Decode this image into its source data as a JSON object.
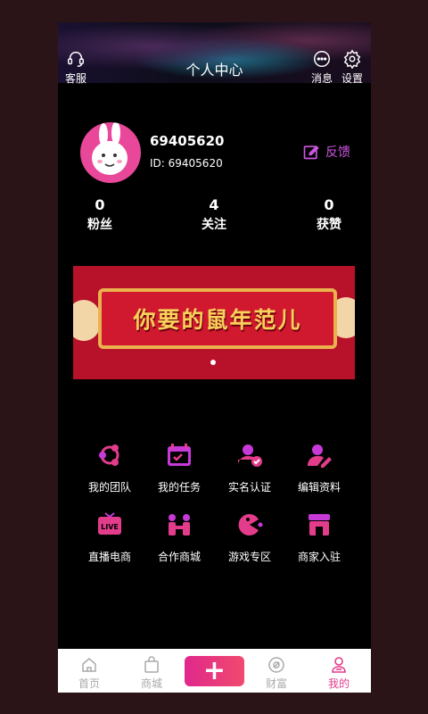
{
  "header": {
    "title": "个人中心",
    "service_label": "客服",
    "message_label": "消息",
    "settings_label": "设置"
  },
  "profile": {
    "username": "69405620",
    "id_text": "ID: 69405620",
    "feedback_label": "反馈"
  },
  "stats": [
    {
      "value": "0",
      "label": "粉丝"
    },
    {
      "value": "4",
      "label": "关注"
    },
    {
      "value": "0",
      "label": "获赞"
    }
  ],
  "banner": {
    "text": "你要的鼠年范儿"
  },
  "grid": [
    {
      "label": "我的团队",
      "icon": "team-icon"
    },
    {
      "label": "我的任务",
      "icon": "task-icon"
    },
    {
      "label": "实名认证",
      "icon": "verify-icon"
    },
    {
      "label": "编辑资料",
      "icon": "edit-profile-icon"
    },
    {
      "label": "直播电商",
      "icon": "live-icon"
    },
    {
      "label": "合作商城",
      "icon": "mall-icon"
    },
    {
      "label": "游戏专区",
      "icon": "game-icon"
    },
    {
      "label": "商家入驻",
      "icon": "store-icon"
    }
  ],
  "live_icon_text": "LIVE",
  "tabs": [
    {
      "label": "首页",
      "icon": "home-icon"
    },
    {
      "label": "商城",
      "icon": "shop-bag-icon"
    },
    {
      "label": "+",
      "icon": "plus-icon"
    },
    {
      "label": "财富",
      "icon": "wealth-icon"
    },
    {
      "label": "我的",
      "icon": "user-icon",
      "active": true
    }
  ],
  "colors": {
    "accent": "#e23c8a",
    "feedback": "#cc55e0",
    "banner": "#b8112a"
  }
}
